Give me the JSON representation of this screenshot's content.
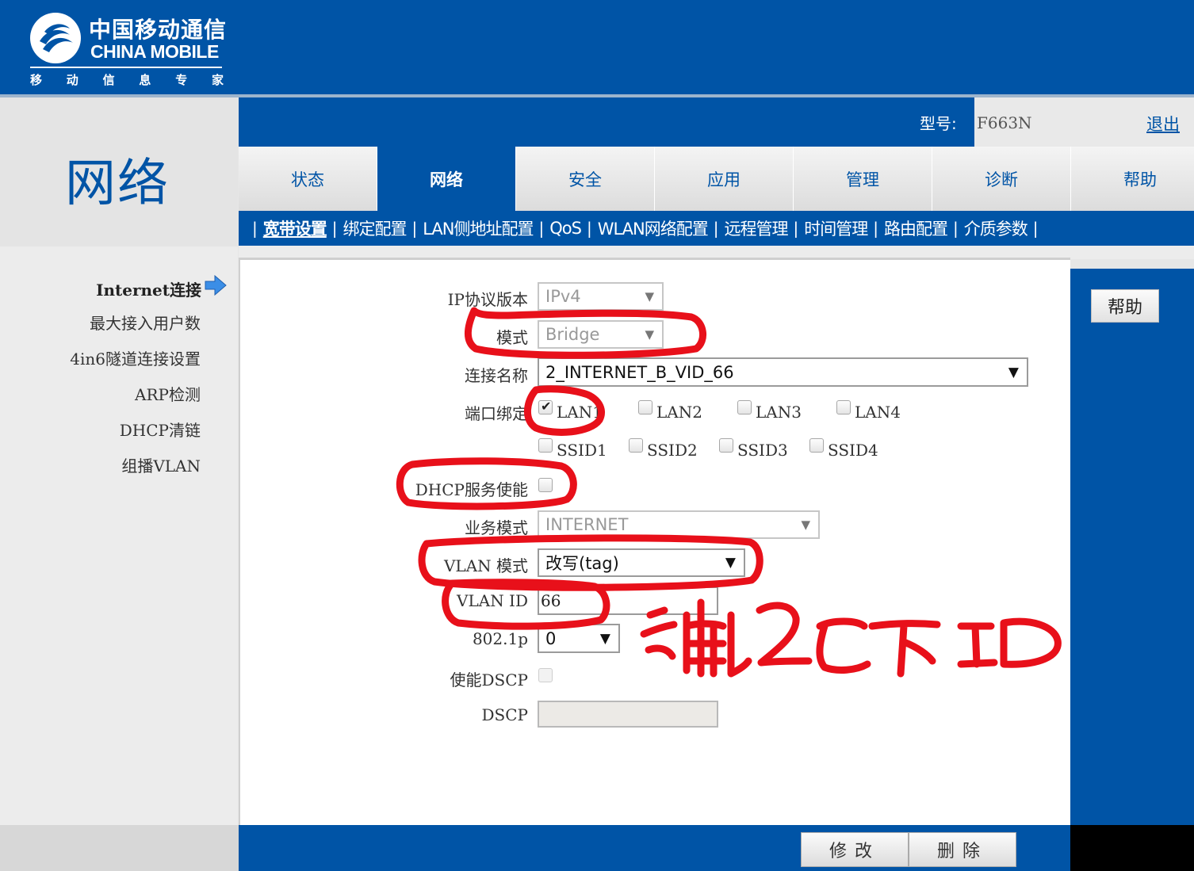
{
  "brand": {
    "name_cn": "中国移动通信",
    "name_en": "CHINA MOBILE",
    "slogan_chars": [
      "移",
      "动",
      "信",
      "息",
      "专",
      "家"
    ]
  },
  "header": {
    "model_label": "型号:",
    "model_value": "F663N",
    "logout": "退出"
  },
  "section_title": "网络",
  "tabs": [
    {
      "label": "状态"
    },
    {
      "label": "网络"
    },
    {
      "label": "安全"
    },
    {
      "label": "应用"
    },
    {
      "label": "管理"
    },
    {
      "label": "诊断"
    },
    {
      "label": "帮助"
    }
  ],
  "subnav": {
    "separator": "|",
    "items": [
      {
        "label": "宽带设置"
      },
      {
        "label": "绑定配置"
      },
      {
        "label": "LAN侧地址配置"
      },
      {
        "label": "QoS"
      },
      {
        "label": "WLAN网络配置"
      },
      {
        "label": "远程管理"
      },
      {
        "label": "时间管理"
      },
      {
        "label": "路由配置"
      },
      {
        "label": "介质参数"
      }
    ]
  },
  "left_nav": [
    {
      "label": "Internet连接"
    },
    {
      "label": "最大接入用户数"
    },
    {
      "label": "4in6隧道连接设置"
    },
    {
      "label": "ARP检测"
    },
    {
      "label": "DHCP清链"
    },
    {
      "label": "组播VLAN"
    }
  ],
  "form": {
    "ip_version": {
      "label": "IP协议版本",
      "value": "IPv4"
    },
    "mode": {
      "label": "模式",
      "value": "Bridge"
    },
    "connection_name": {
      "label": "连接名称",
      "value": "2_INTERNET_B_VID_66"
    },
    "port_binding": {
      "label": "端口绑定",
      "ports": [
        {
          "label": "LAN1",
          "checked": true
        },
        {
          "label": "LAN2",
          "checked": false
        },
        {
          "label": "LAN3",
          "checked": false
        },
        {
          "label": "LAN4",
          "checked": false
        },
        {
          "label": "SSID1",
          "checked": false
        },
        {
          "label": "SSID2",
          "checked": false
        },
        {
          "label": "SSID3",
          "checked": false
        },
        {
          "label": "SSID4",
          "checked": false
        }
      ]
    },
    "dhcp_enable": {
      "label": "DHCP服务使能",
      "checked": false
    },
    "service_mode": {
      "label": "业务模式",
      "value": "INTERNET"
    },
    "vlan_mode": {
      "label": "VLAN 模式",
      "value": "改写(tag)"
    },
    "vlan_id": {
      "label": "VLAN ID",
      "value": "66"
    },
    "p8021": {
      "label": "802.1p",
      "value": "0"
    },
    "dscp_enable": {
      "label": "使能DSCP",
      "checked": false
    },
    "dscp": {
      "label": "DSCP",
      "value": ""
    }
  },
  "help_button": "帮助",
  "actions": {
    "modify": "修改",
    "delete": "删除"
  },
  "colors": {
    "brand_blue": "#0054a6",
    "annotation_red": "#e8101a"
  },
  "icons": {
    "logo": "china-mobile-logo-icon",
    "nav_arrow": "arrow-right-icon",
    "select_caret": "caret-down-icon",
    "checkmark": "checkmark-icon"
  }
}
